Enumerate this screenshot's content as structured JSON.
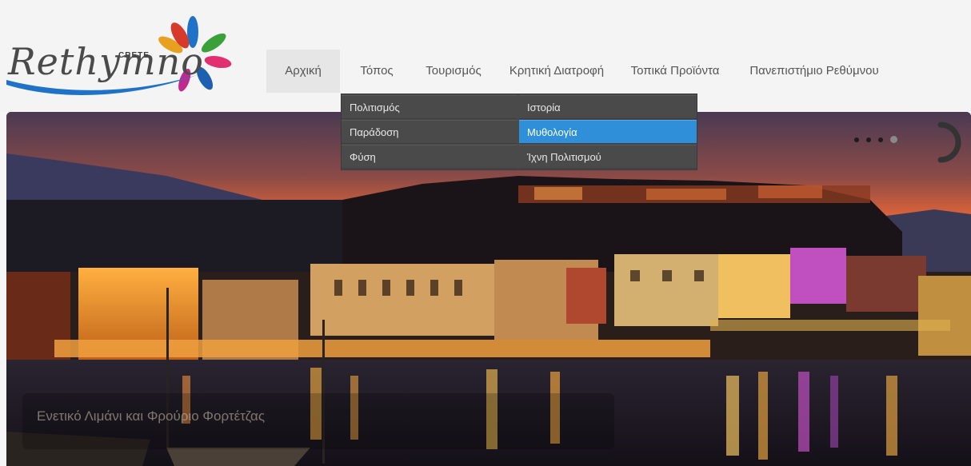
{
  "logo": {
    "wordmark": "Rethymno",
    "region": "CRETE"
  },
  "nav": {
    "items": [
      {
        "label": "Αρχική"
      },
      {
        "label": "Τόπος"
      },
      {
        "label": "Τουρισμός"
      },
      {
        "label": "Κρητική Διατροφή"
      },
      {
        "label": "Τοπικά Προϊόντα"
      },
      {
        "label": "Πανεπιστήμιο Ρεθύμνου"
      }
    ],
    "active_index": 0
  },
  "dropdown": {
    "parent": "Τόπος",
    "items": [
      {
        "label": "Πολιτισμός"
      },
      {
        "label": "Ιστορία"
      },
      {
        "label": "Παράδοση"
      },
      {
        "label": "Μυθολογία"
      },
      {
        "label": "Φύση"
      },
      {
        "label": "Ίχνη Πολιτισμού"
      }
    ],
    "selected": "Μυθολογία"
  },
  "slider": {
    "caption": "Ενετικό Λιμάνι και Φρούριο Φορτέτζας",
    "slide_count": 4,
    "current_slide": 4
  },
  "colors": {
    "dropdown_bg": "#4a4a4a",
    "dropdown_selected": "#2f8fd8",
    "nav_active_bg": "#e6e6e6",
    "logo_blue": "#1e73c8"
  },
  "icons": {
    "slider_loader": "circle-loader-icon",
    "pager": "pager-dot-icon"
  }
}
